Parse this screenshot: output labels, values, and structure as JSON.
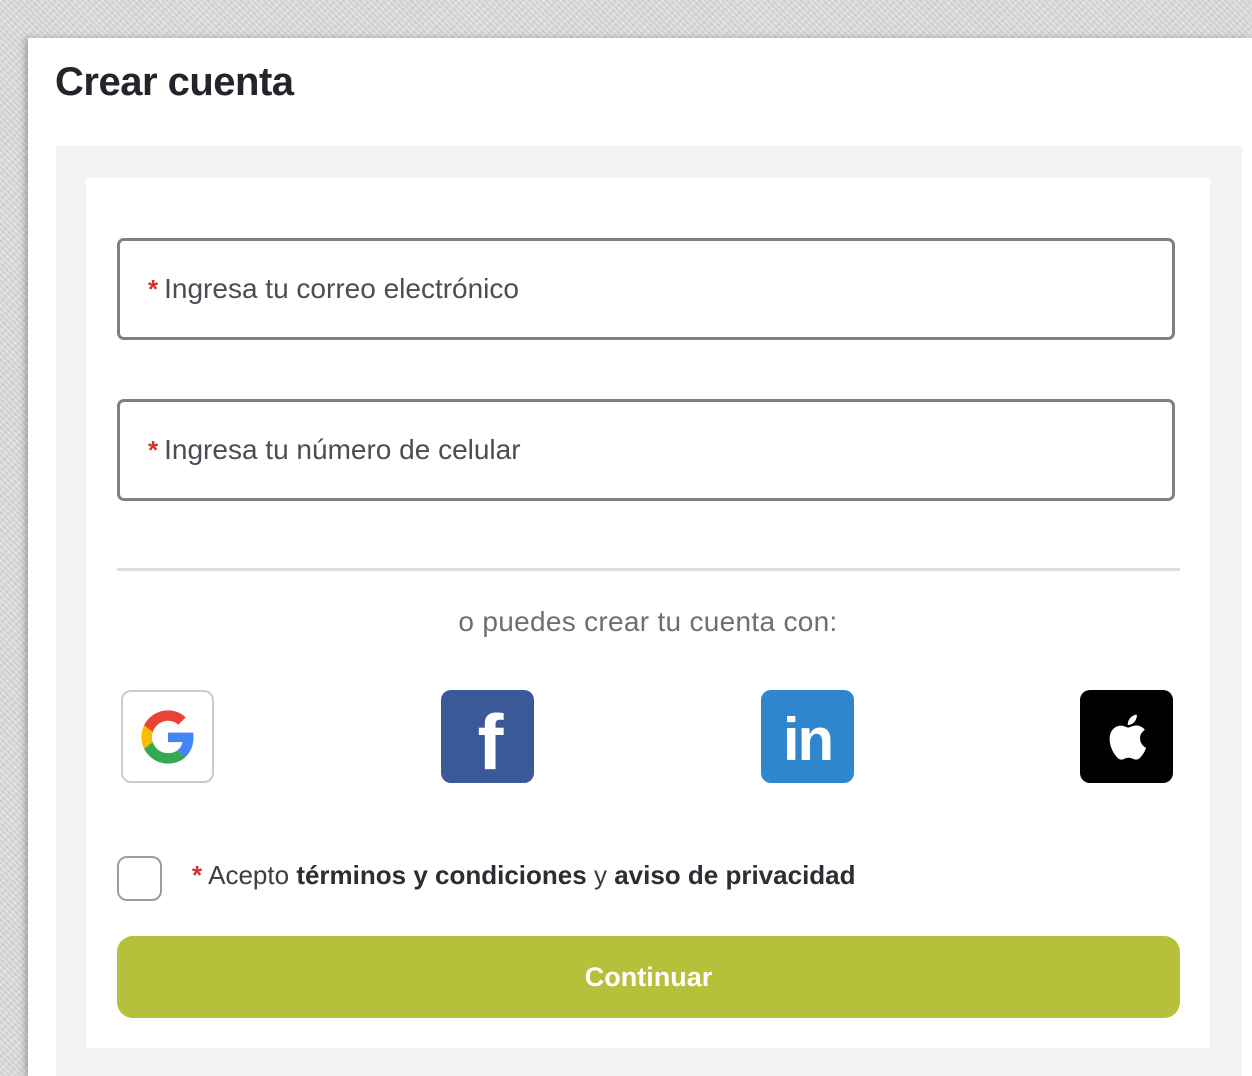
{
  "page": {
    "title": "Crear cuenta"
  },
  "form": {
    "email_placeholder": "Ingresa tu correo electrónico",
    "phone_placeholder": "Ingresa tu número de celular",
    "required_mark": "*",
    "alt_text": "o puedes crear tu cuenta con:",
    "social": [
      {
        "provider": "Google",
        "icon": "google-icon"
      },
      {
        "provider": "Facebook",
        "icon": "facebook-icon",
        "glyph": "f",
        "color": "#3b5998"
      },
      {
        "provider": "LinkedIn",
        "icon": "linkedin-icon",
        "glyph": "in",
        "color": "#2f86cc"
      },
      {
        "provider": "Apple",
        "icon": "apple-icon",
        "color": "#000000"
      }
    ],
    "terms": {
      "prefix": "Acepto",
      "terms_link": "términos y condiciones",
      "connector": "y",
      "privacy_link": "aviso de privacidad",
      "checked": false
    },
    "continue_label": "Continuar"
  },
  "colors": {
    "accent": "#b6c03a",
    "required": "#d0342c"
  }
}
